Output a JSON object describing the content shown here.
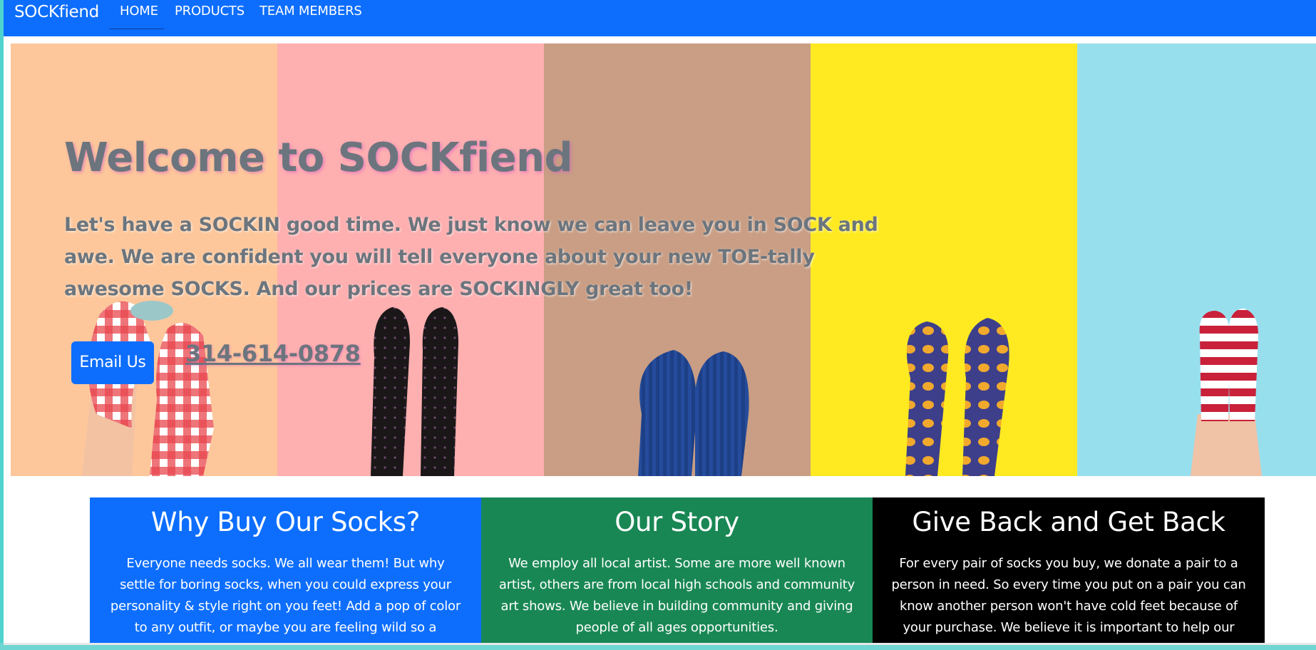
{
  "navbar": {
    "brand": "SOCKfiend",
    "links": [
      {
        "label": "HOME",
        "active": true
      },
      {
        "label": "PRODUCTS"
      },
      {
        "label": "TEAM MEMBERS"
      }
    ]
  },
  "hero": {
    "title": "Welcome to SOCKfiend",
    "text": "Let's have a SOCKIN good time. We just know we can leave you in SOCK and awe. We are confident you will tell everyone about your new TOE-tally awesome SOCKS. And our prices are SOCKINGLY great too!",
    "email_button": "Email Us",
    "phone": "314-614-0878",
    "stripe_colors": [
      "#fdc79b",
      "#feafb0",
      "#c99e84",
      "#ffea21",
      "#98dfee"
    ]
  },
  "cards": [
    {
      "title": "Why Buy Our Socks?",
      "text": "Everyone needs socks. We all wear them! But why settle for boring socks, when you could express your personality & style right on you feet! Add a pop of color to any outfit, or maybe you are feeling wild so a",
      "color": "#0d6efd"
    },
    {
      "title": "Our Story",
      "text": "We employ all local artist. Some are more well known artist, others are from local high schools and community art shows. We believe in building community and giving people of all ages opportunities.",
      "color": "#198754"
    },
    {
      "title": "Give Back and Get Back",
      "text": "For every pair of socks you buy, we donate a pair to a person in need. So every time you put on a pair you can know another person won't have cold feet because of your purchase. We believe it is important to help our",
      "color": "#000000"
    }
  ],
  "colors": {
    "primary": "#0d6efd",
    "success": "#198754",
    "muted_text": "#6c757d"
  }
}
